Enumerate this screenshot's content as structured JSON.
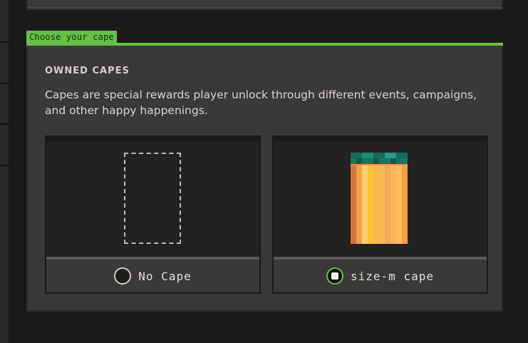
{
  "section": {
    "tab_label": "Choose your cape",
    "heading": "OWNED CAPES",
    "description": "Capes are special rewards player unlock through different events, campaigns, and other happy happenings."
  },
  "capes": [
    {
      "label": "No Cape",
      "selected": false,
      "icon": "empty-cape-outline"
    },
    {
      "label": "size-m cape",
      "selected": true,
      "icon": "orange-cape-pixel-art"
    }
  ],
  "colors": {
    "accent_green": "#63c144",
    "panel_bg": "#3a3938",
    "page_bg": "#1b1a19",
    "card_bg": "#232221",
    "cape_top": "#0f6f5d",
    "cape_orange": "#f5a94c",
    "cape_yellow": "#f7c531"
  }
}
